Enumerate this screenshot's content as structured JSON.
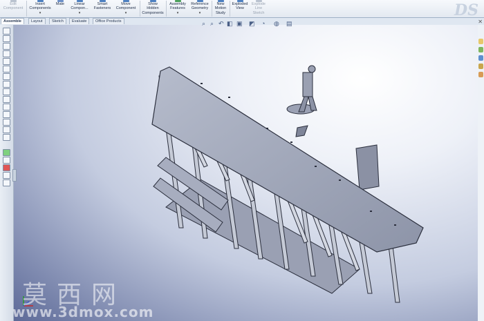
{
  "ribbon": {
    "buttons": [
      {
        "line1": "Edit",
        "line2": "Component",
        "line3": "",
        "disabled": true
      },
      {
        "line1": "Insert",
        "line2": "Components",
        "line3": "▾",
        "disabled": false
      },
      {
        "line1": "Mate",
        "line2": "",
        "line3": "",
        "disabled": false
      },
      {
        "line1": "Linear",
        "line2": "Compon...",
        "line3": "▾",
        "disabled": false
      },
      {
        "line1": "Smart",
        "line2": "Fasteners",
        "line3": "",
        "disabled": false
      },
      {
        "line1": "Move",
        "line2": "Component",
        "line3": "▾",
        "disabled": false
      },
      {
        "line1": "Show",
        "line2": "Hidden",
        "line3": "Components",
        "disabled": false
      },
      {
        "line1": "Assembly",
        "line2": "Features",
        "line3": "▾",
        "disabled": false
      },
      {
        "line1": "Reference",
        "line2": "Geometry",
        "line3": "▾",
        "disabled": false
      },
      {
        "line1": "New",
        "line2": "Motion",
        "line3": "Study",
        "disabled": false
      },
      {
        "line1": "Exploded",
        "line2": "View",
        "line3": "",
        "disabled": false
      },
      {
        "line1": "Explode",
        "line2": "Line",
        "line3": "Sketch",
        "disabled": true
      }
    ],
    "logo": "DS"
  },
  "tabs": [
    "Assemble",
    "Layout",
    "Sketch",
    "Evaluate",
    "Office Products"
  ],
  "active_tab": "Assemble",
  "watermark": {
    "cn": "莫西网",
    "url": "www.3dmox.com"
  }
}
